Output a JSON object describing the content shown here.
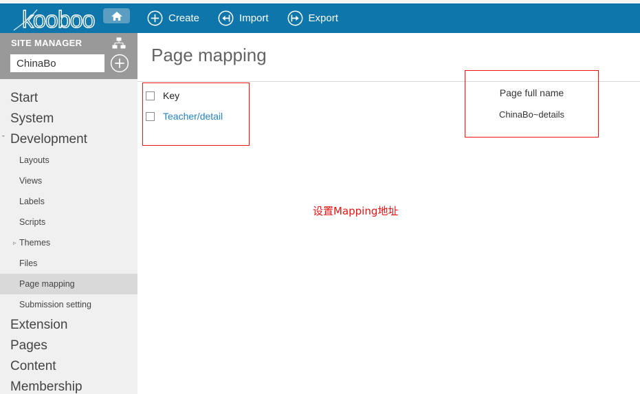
{
  "topbar": {
    "logo_text": "kooboo",
    "home_icon": "home-icon",
    "nav": [
      {
        "label": "Create",
        "icon": "plus-circle-icon"
      },
      {
        "label": "Import",
        "icon": "import-arrow-circle-icon"
      },
      {
        "label": "Export",
        "icon": "export-arrow-circle-icon"
      }
    ]
  },
  "sidebar": {
    "site_manager": {
      "title": "SITE MANAGER",
      "tree_icon": "sitemap-icon",
      "site_value": "ChinaBo",
      "site_placeholder": "ChinaBo",
      "add_icon": "plus-circle-icon"
    },
    "items": [
      {
        "label": "Start",
        "level": "top",
        "caret": "",
        "active": false
      },
      {
        "label": "System",
        "level": "top",
        "caret": "",
        "active": false
      },
      {
        "label": "Development",
        "level": "top",
        "caret": "ˇ",
        "active": false
      },
      {
        "label": "Layouts",
        "level": "sub",
        "caret": "",
        "active": false
      },
      {
        "label": "Views",
        "level": "sub",
        "caret": "",
        "active": false
      },
      {
        "label": "Labels",
        "level": "sub",
        "caret": "",
        "active": false
      },
      {
        "label": "Scripts",
        "level": "sub",
        "caret": "",
        "active": false
      },
      {
        "label": "Themes",
        "level": "sub",
        "caret": "▹",
        "active": false
      },
      {
        "label": "Files",
        "level": "sub",
        "caret": "",
        "active": false
      },
      {
        "label": "Page mapping",
        "level": "sub",
        "caret": "",
        "active": true
      },
      {
        "label": "Submission setting",
        "level": "sub",
        "caret": "",
        "active": false
      },
      {
        "label": "Extension",
        "level": "top",
        "caret": "",
        "active": false
      },
      {
        "label": "Pages",
        "level": "top",
        "caret": "",
        "active": false
      },
      {
        "label": "Content",
        "level": "top",
        "caret": "",
        "active": false
      },
      {
        "label": "Membership",
        "level": "top",
        "caret": "",
        "active": false
      }
    ]
  },
  "main": {
    "page_title": "Page mapping",
    "mapping_rows": [
      {
        "label": "Key",
        "is_link": false
      },
      {
        "label": "Teacher/detail",
        "is_link": true
      }
    ],
    "page_full_name": {
      "title": "Page full name",
      "value": "ChinaBo~details"
    },
    "annotation": "设置Mapping地址"
  },
  "colors": {
    "brand_blue": "#0f76ab",
    "sidebar_gray": "#f0f0f0",
    "site_manager_gray": "#999999",
    "active_row": "#d9d9d9",
    "annotation_red": "#ee1111",
    "link_blue": "#2682c3"
  }
}
